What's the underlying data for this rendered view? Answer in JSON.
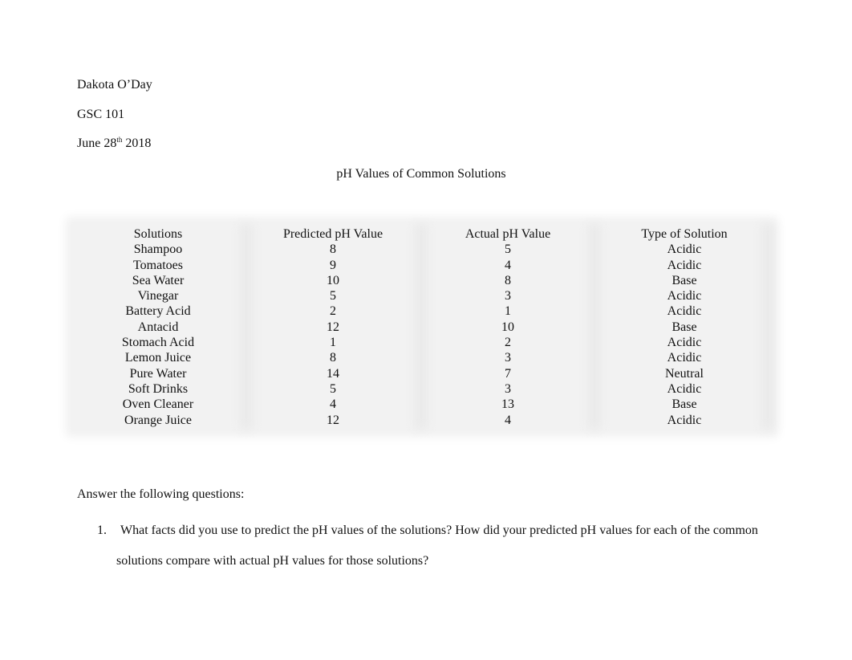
{
  "header": {
    "author": "Dakota O’Day",
    "course": "GSC 101",
    "date_prefix": "June 28",
    "date_suffix": "th",
    "date_year": " 2018"
  },
  "title": "pH Values of Common Solutions",
  "table": {
    "columns": [
      "Solutions",
      "Predicted pH Value",
      "Actual pH Value",
      "Type of Solution"
    ],
    "rows": [
      [
        "Shampoo",
        "8",
        "5",
        "Acidic"
      ],
      [
        "Tomatoes",
        "9",
        "4",
        "Acidic"
      ],
      [
        "Sea Water",
        "10",
        "8",
        "Base"
      ],
      [
        "Vinegar",
        "5",
        "3",
        "Acidic"
      ],
      [
        "Battery Acid",
        "2",
        "1",
        "Acidic"
      ],
      [
        "Antacid",
        "12",
        "10",
        "Base"
      ],
      [
        "Stomach Acid",
        "1",
        "2",
        "Acidic"
      ],
      [
        "Lemon Juice",
        "8",
        "3",
        "Acidic"
      ],
      [
        "Pure Water",
        "14",
        "7",
        "Neutral"
      ],
      [
        "Soft Drinks",
        "5",
        "3",
        "Acidic"
      ],
      [
        "Oven Cleaner",
        "4",
        "13",
        "Base"
      ],
      [
        "Orange Juice",
        "12",
        "4",
        "Acidic"
      ]
    ]
  },
  "questions": {
    "intro": "Answer the following questions:",
    "items": [
      {
        "number": "1.",
        "line1": "What facts did you use to predict the pH values of the solutions?  How did your predicted pH values for each of the common",
        "line2": "solutions compare with actual pH values for those solutions?"
      }
    ]
  }
}
